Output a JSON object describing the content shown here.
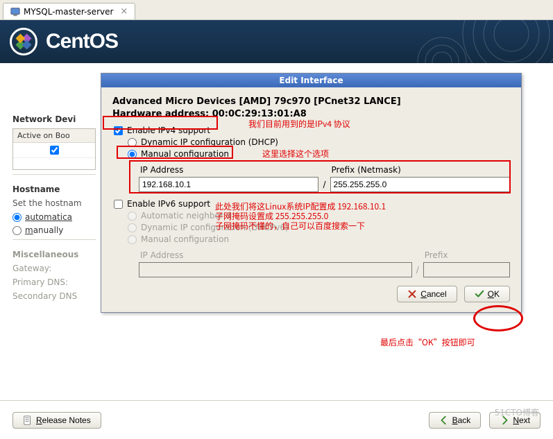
{
  "tab": {
    "title": "MYSQL-master-server"
  },
  "brand": "CentOS",
  "sidebar": {
    "heading_network": "Network Devi",
    "table_header": "Active on Boo",
    "heading_hostname": "Hostname",
    "set_hostname": "Set the hostnam",
    "radio_auto": "automatica",
    "radio_manual": "manually",
    "heading_misc": "Miscellaneous",
    "gateway": "Gateway:",
    "primary_dns": "Primary DNS:",
    "secondary_dns": "Secondary DNS"
  },
  "dialog": {
    "title": "Edit Interface",
    "dev_line1": "Advanced Micro Devices [AMD] 79c970 [PCnet32 LANCE]",
    "dev_line2": "Hardware address: 00:0C:29:13:01:A8",
    "enable_ipv4": "Enable IPv4 support",
    "dhcp4": "Dynamic IP configuration (DHCP)",
    "manual4": "Manual configuration",
    "ip_label": "IP Address",
    "prefix_label": "Prefix (Netmask)",
    "ip_value": "192.168.10.1",
    "prefix_value": "255.255.255.0",
    "enable_ipv6": "Enable IPv6 support",
    "auto6": "Automatic neighbor d",
    "dhcp6": "Dynamic IP configuration (DHCPv6)",
    "manual6": "Manual configuration",
    "ip6_label": "IP Address",
    "prefix6_label": "Prefix",
    "cancel": "Cancel",
    "ok": "OK"
  },
  "annotations": {
    "a1": "我们目前用到的是IPv4 协议",
    "a2": "这里选择这个选项",
    "a3_l1": "此处我们将这Linux系统IP配置成 192.168.10.1",
    "a3_l2": "子网掩码设置成 255.255.255.0",
    "a3_l3": "子网掩码不懂的，自己可以百度搜索一下",
    "a4": "最后点击“OK”按钮即可"
  },
  "footer": {
    "release_notes": "Release Notes",
    "back": "Back",
    "next": "Next"
  },
  "watermark": "51CTO博客"
}
